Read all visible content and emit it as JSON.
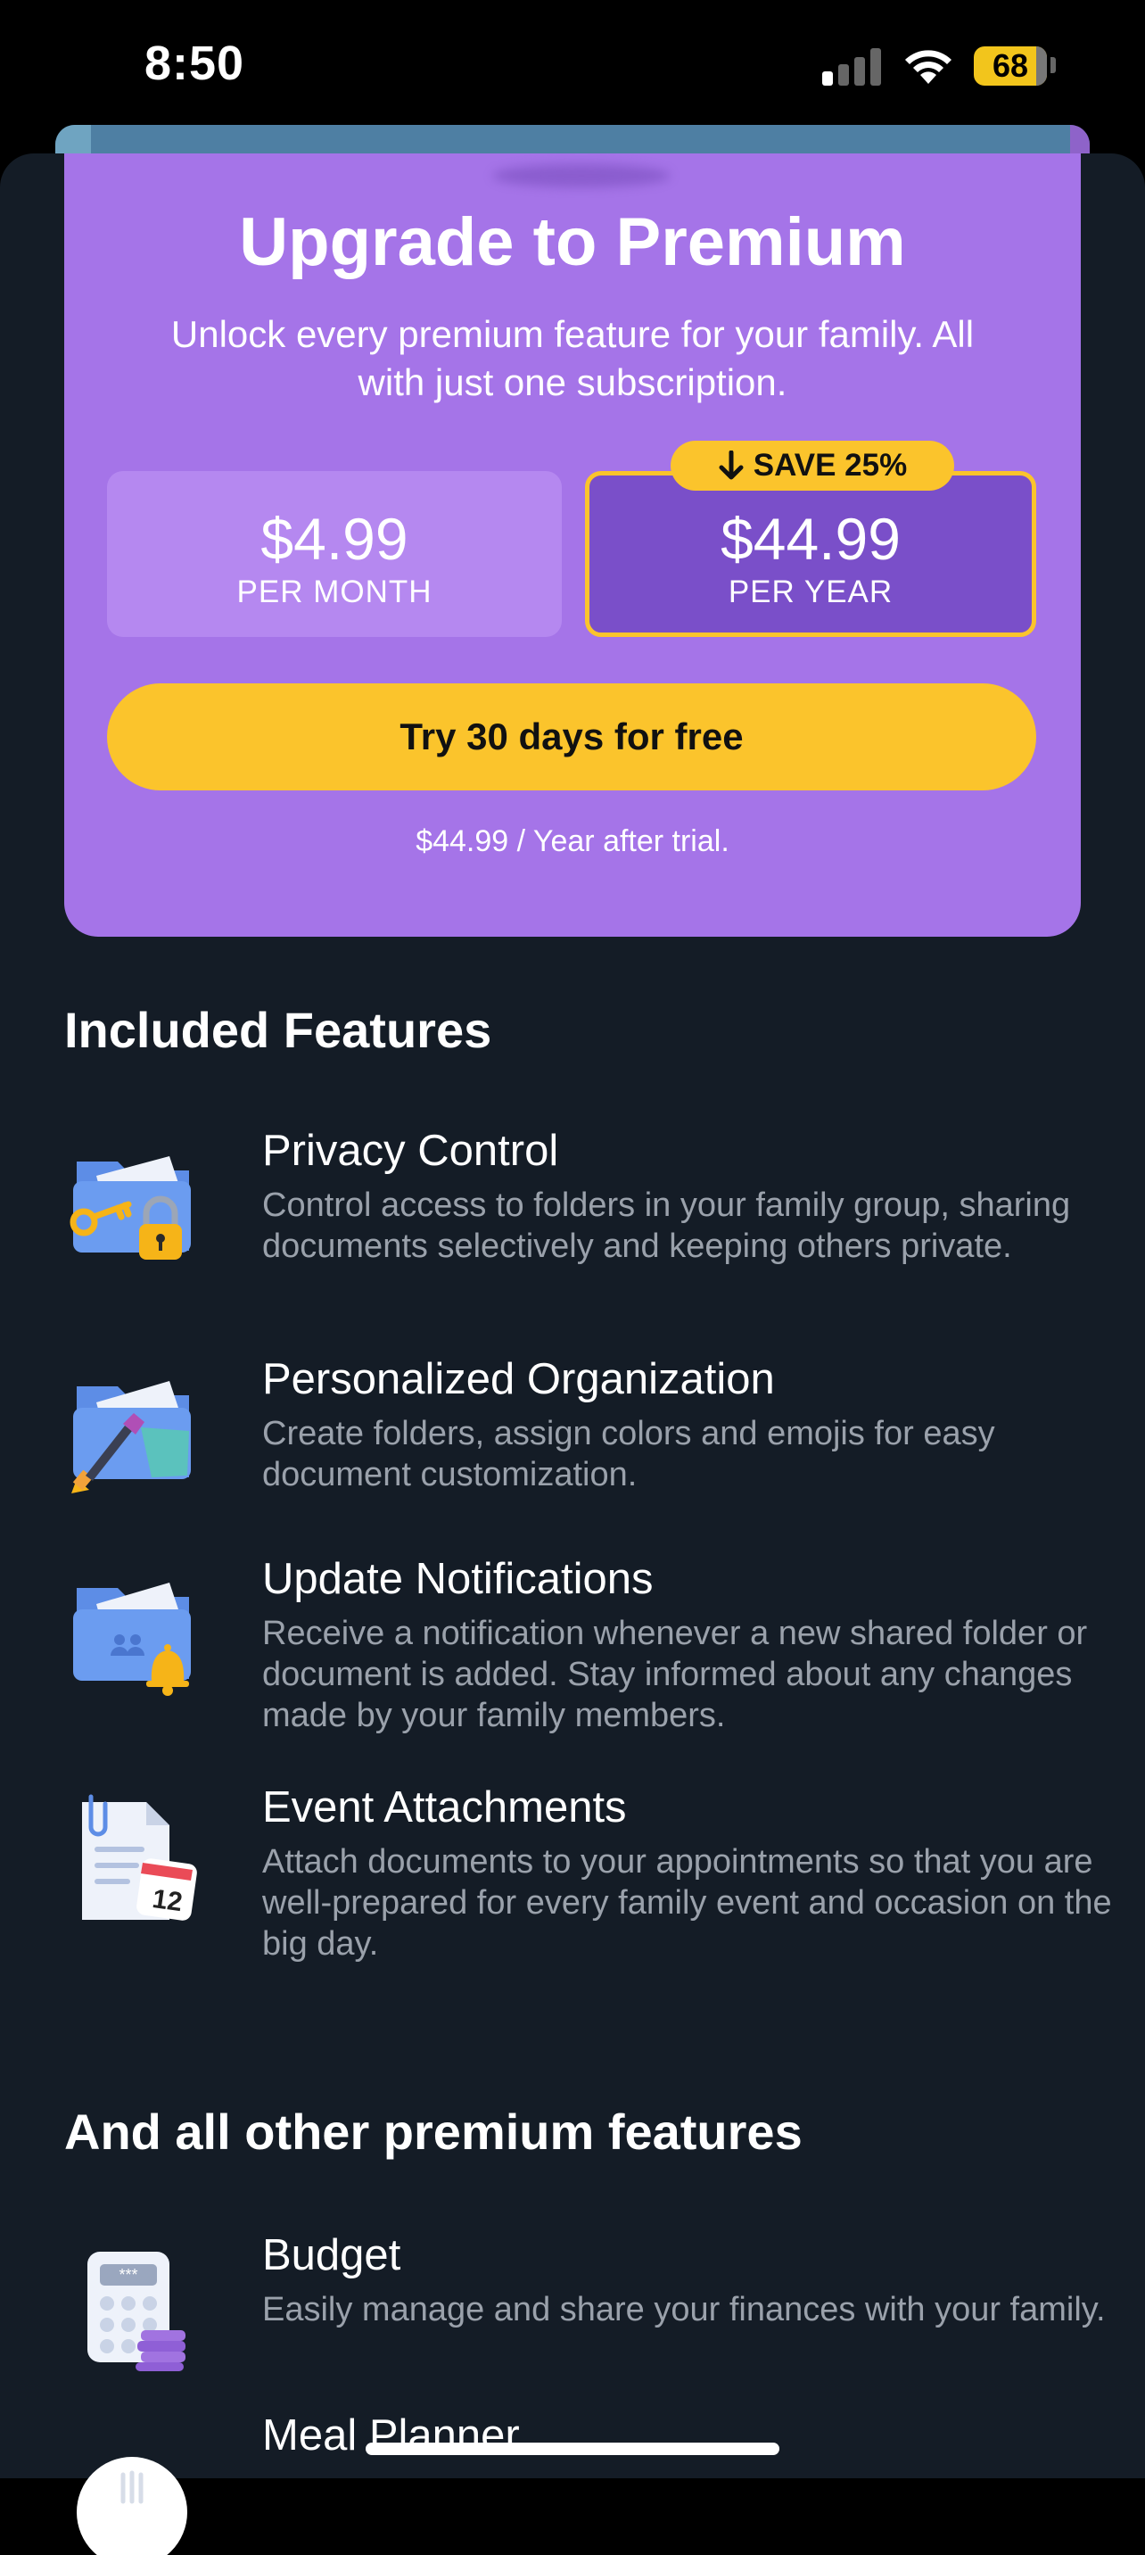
{
  "status_bar": {
    "time": "8:50",
    "battery": "68"
  },
  "card": {
    "title": "Upgrade to Premium",
    "subtitle": "Unlock every premium feature for your family. All with just one subscription.",
    "plans": [
      {
        "price": "$4.99",
        "period": "PER MONTH"
      },
      {
        "price": "$44.99",
        "period": "PER YEAR",
        "badge": "SAVE 25%"
      }
    ],
    "cta": "Try 30 days for free",
    "trial_note": "$44.99 / Year after trial."
  },
  "included": {
    "title": "Included Features",
    "items": [
      {
        "name": "Privacy Control",
        "desc": "Control access to folders in your family group, sharing documents selectively and keeping others private.",
        "icon": "folder-key-lock-icon"
      },
      {
        "name": "Personalized Organization",
        "desc": "Create folders, assign colors and emojis for easy document customization.",
        "icon": "folder-paintbrush-icon"
      },
      {
        "name": "Update Notifications",
        "desc": "Receive a notification whenever a new shared folder or document is added. Stay informed about any changes made by your family members.",
        "icon": "folder-bell-icon"
      },
      {
        "name": "Event Attachments",
        "desc": "Attach documents to your appointments so that you are well-prepared for every family event and occasion on the big day.",
        "icon": "document-calendar-icon"
      }
    ]
  },
  "others": {
    "title": "And all other premium features",
    "items": [
      {
        "name": "Budget",
        "desc": "Easily manage and share your finances with your family.",
        "icon": "calculator-coins-icon"
      },
      {
        "name": "Meal Planner",
        "icon": "meal-plate-icon"
      }
    ]
  },
  "calendar_day": "12",
  "colors": {
    "card": "#a574e8",
    "accent": "#fbc42c",
    "background": "#141c26"
  }
}
